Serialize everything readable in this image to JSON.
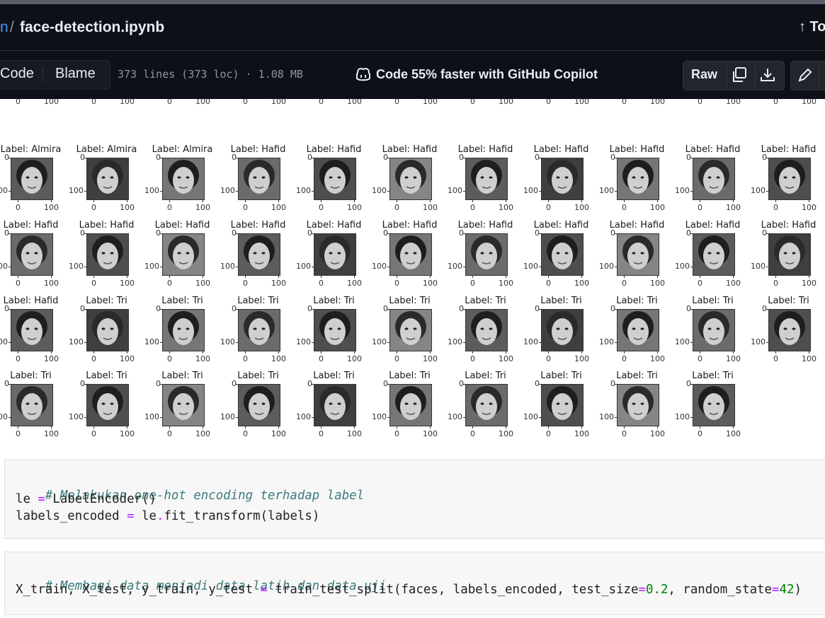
{
  "breadcrumb": {
    "repo_fragment": "n",
    "separator": "/",
    "file_name": "face-detection.ipynb"
  },
  "top_link": "↑ To",
  "view_tabs": {
    "code": "Code",
    "blame": "Blame"
  },
  "file_meta": "373 lines (373 loc) · 1.08 MB",
  "copilot_text": "Code 55% faster with GitHub Copilot",
  "toolbar": {
    "raw": "Raw",
    "icons": [
      "copy-icon",
      "download-icon",
      "pencil-icon"
    ]
  },
  "colors": {
    "header_bg": "#0d1117",
    "link": "#4493f8",
    "text": "#e6edf3",
    "muted": "#8d96a0",
    "code_bg": "#f7f7f7",
    "comment": "#3d7b7b",
    "operator": "#aa22ff",
    "number": "#008000"
  },
  "faces": {
    "axis_ticks": [
      "0",
      "100"
    ],
    "top_row_labels": [
      "",
      "",
      "",
      "",
      "",
      "",
      "",
      "",
      "",
      "",
      ""
    ],
    "rows": [
      [
        "Label: Almira",
        "Label: Almira",
        "Label: Almira",
        "Label: Hafid",
        "Label: Hafid",
        "Label: Hafid",
        "Label: Hafid",
        "Label: Hafid",
        "Label: Hafid",
        "Label: Hafid",
        "Label: Hafid"
      ],
      [
        "Label: Hafid",
        "Label: Hafid",
        "Label: Hafid",
        "Label: Hafid",
        "Label: Hafid",
        "Label: Hafid",
        "Label: Hafid",
        "Label: Hafid",
        "Label: Hafid",
        "Label: Hafid",
        "Label: Hafid"
      ],
      [
        "Label: Hafid",
        "Label: Tri",
        "Label: Tri",
        "Label: Tri",
        "Label: Tri",
        "Label: Tri",
        "Label: Tri",
        "Label: Tri",
        "Label: Tri",
        "Label: Tri",
        "Label: Tri"
      ],
      [
        "Label: Tri",
        "Label: Tri",
        "Label: Tri",
        "Label: Tri",
        "Label: Tri",
        "Label: Tri",
        "Label: Tri",
        "Label: Tri",
        "Label: Tri",
        "Label: Tri"
      ]
    ]
  },
  "code_cells": [
    {
      "comment": "# Melakukan one-hot encoding terhadap label",
      "line2": {
        "a": "le ",
        "op": "=",
        "b": " LabelEncoder()"
      },
      "line3": {
        "a": "labels_encoded ",
        "op1": "=",
        "b": " le",
        "op2": ".",
        "c": "fit_transform(labels)"
      }
    },
    {
      "comment": "# Membagi data menjadi data latih dan data uji",
      "line2": {
        "a": "X_train, X_test, y_train, y_test ",
        "op1": "=",
        "b": " train_test_split(faces, labels_encoded, test_size",
        "op2": "=",
        "n1": "0.2",
        "c": ", random_state",
        "op3": "=",
        "n2": "42",
        "d": ")"
      }
    }
  ]
}
